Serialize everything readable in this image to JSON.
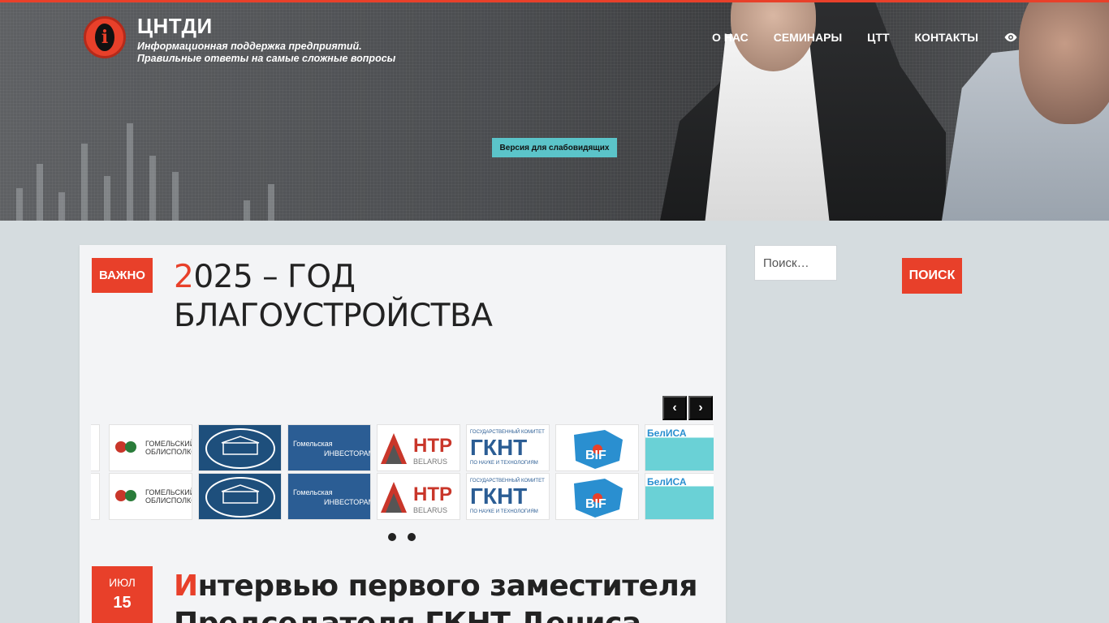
{
  "header": {
    "site_name": "ЦНТДИ",
    "tagline_line1": "Информационная поддержка предприятий.",
    "tagline_line2": "Правильные ответы на самые сложные вопросы",
    "nav": [
      {
        "label": "О НАС"
      },
      {
        "label": "СЕМИНАРЫ"
      },
      {
        "label": "ЦТТ"
      },
      {
        "label": "КОНТАКТЫ"
      }
    ],
    "accessibility_label": "Версия для слабовидящих"
  },
  "post1": {
    "badge": "ВАЖНО",
    "title_first": "2",
    "title_rest": "025 – ГОД БЛАГОУСТРОЙСТВА"
  },
  "carousel": {
    "logos": [
      {
        "name": "Гомельский облисполком",
        "line1": "ГОМЕЛЬСКИЙ",
        "line2": "ОБЛИСПОЛКОМ"
      },
      {
        "name": "Совет Министров",
        "line1": "",
        "line2": ""
      },
      {
        "name": "Гомельская область инвесторам",
        "line1": "Гомельская",
        "line2": "ИНВЕСТОРАМ"
      },
      {
        "name": "НТР Belarus",
        "line1": "НТР",
        "line2": "BELARUS"
      },
      {
        "name": "ГКНТ",
        "line1": "ГОСУДАРСТВЕННЫЙ КОМИТЕТ",
        "line2": "ГКНТ",
        "line3": "ПО НАУКЕ И ТЕХНОЛОГИЯМ"
      },
      {
        "name": "BIF",
        "line1": "BIF",
        "line2": ""
      },
      {
        "name": "БелИСА",
        "line1": "БелИСА",
        "line2": ""
      }
    ],
    "prev_label": "‹",
    "next_label": "›"
  },
  "post2": {
    "month": "ИЮЛ",
    "day": "15",
    "title_first": "И",
    "title_rest": "нтервью первого заместителя Председателя ГКНТ Дениса"
  },
  "search": {
    "placeholder": "Поиск…",
    "button_label": "ПОИСК"
  },
  "colors": {
    "accent": "#e8402a",
    "accessibility_btn": "#5bc4c9",
    "page_bg": "#d5dcdf"
  }
}
